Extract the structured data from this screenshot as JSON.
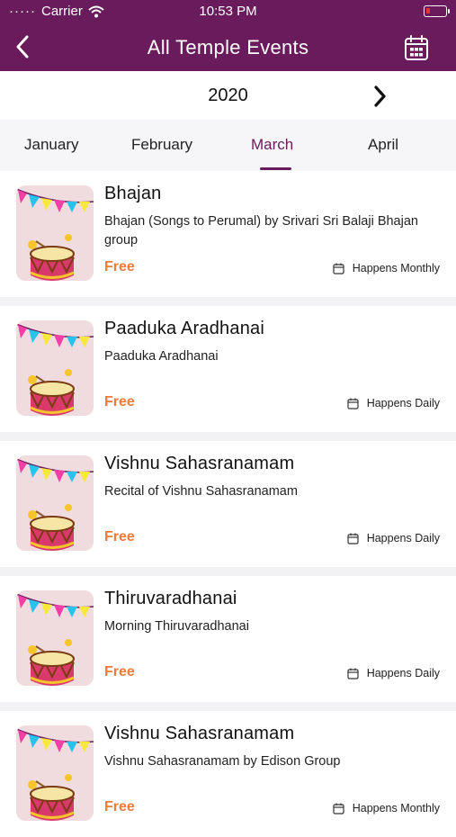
{
  "status": {
    "carrier": "Carrier",
    "time": "10:53 PM"
  },
  "nav": {
    "title": "All Temple Events"
  },
  "year": "2020",
  "months": [
    "January",
    "February",
    "March",
    "April"
  ],
  "active_month": "March",
  "colors": {
    "brand": "#6a1b5c",
    "price": "#f07a3a"
  },
  "events": [
    {
      "title": "Bhajan",
      "description": "Bhajan (Songs to Perumal) by Srivari Sri Balaji Bhajan group",
      "price": "Free",
      "frequency": "Happens Monthly"
    },
    {
      "title": "Paaduka Aradhanai",
      "description": "Paaduka Aradhanai",
      "price": "Free",
      "frequency": "Happens Daily"
    },
    {
      "title": "Vishnu Sahasranamam",
      "description": "Recital of Vishnu Sahasranamam",
      "price": "Free",
      "frequency": "Happens Daily"
    },
    {
      "title": "Thiruvaradhanai",
      "description": "Morning Thiruvaradhanai",
      "price": "Free",
      "frequency": "Happens Daily"
    },
    {
      "title": "Vishnu Sahasranamam",
      "description": "Vishnu Sahasranamam by Edison Group",
      "price": "Free",
      "frequency": "Happens Monthly"
    }
  ]
}
